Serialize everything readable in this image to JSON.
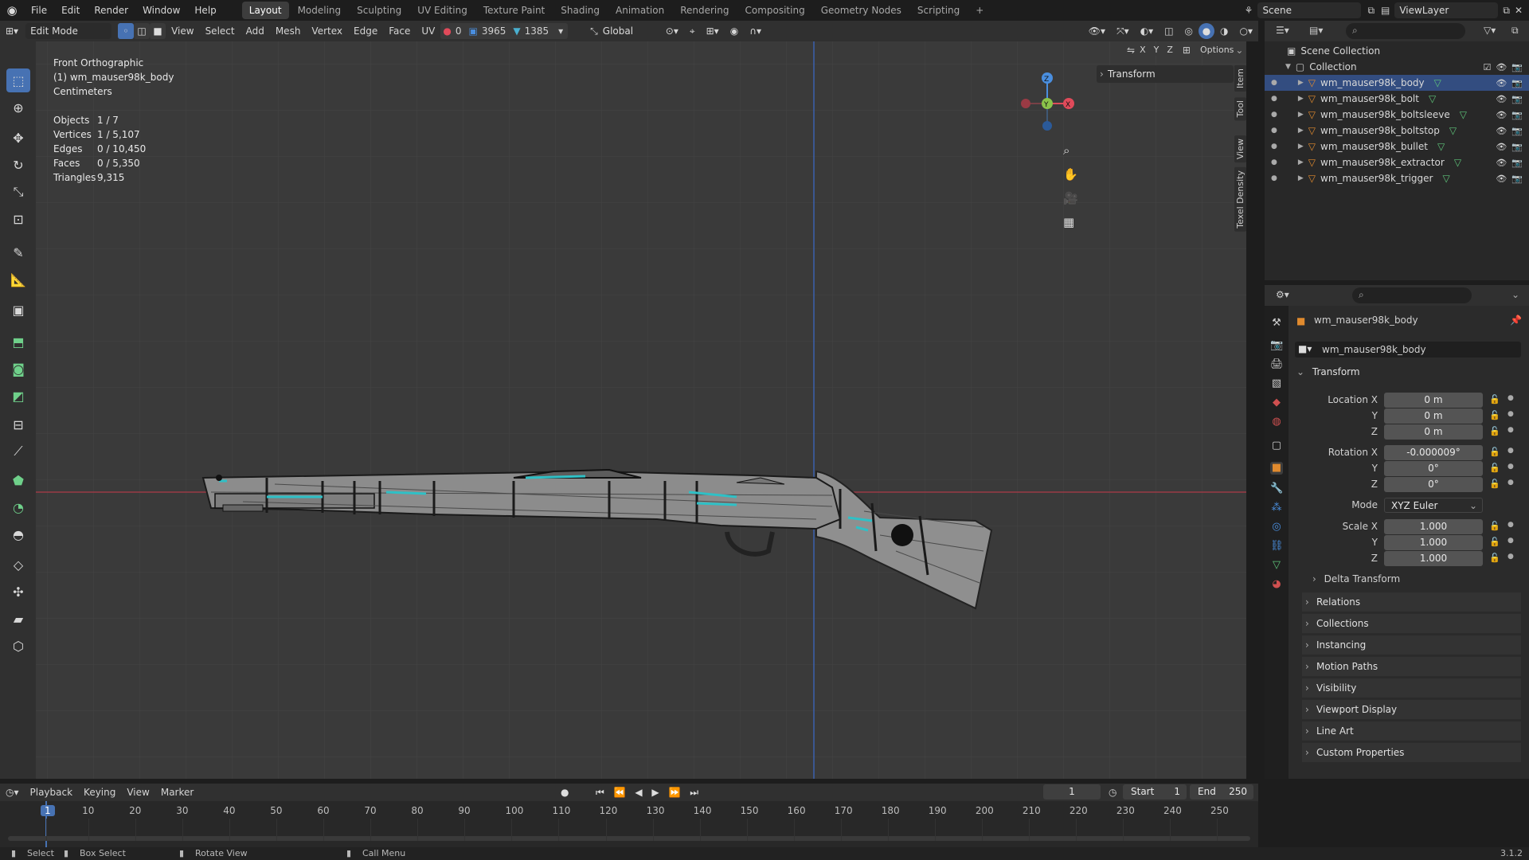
{
  "menu": [
    "File",
    "Edit",
    "Render",
    "Window",
    "Help"
  ],
  "workspaces": [
    "Layout",
    "Modeling",
    "Sculpting",
    "UV Editing",
    "Texture Paint",
    "Shading",
    "Animation",
    "Rendering",
    "Compositing",
    "Geometry Nodes",
    "Scripting"
  ],
  "scene": {
    "name": "Scene",
    "view_layer": "ViewLayer"
  },
  "header": {
    "mode": "Edit Mode",
    "menus": [
      "View",
      "Select",
      "Add",
      "Mesh",
      "Vertex",
      "Edge",
      "Face",
      "UV"
    ],
    "counts": {
      "a": "0",
      "b": "3965",
      "c": "1385"
    },
    "orientation": "Global",
    "options": "Options",
    "axes": [
      "X",
      "Y",
      "Z"
    ]
  },
  "viewport": {
    "view_name": "Front Orthographic",
    "object": "(1) wm_mauser98k_body",
    "units": "Centimeters",
    "stats": [
      {
        "label": "Objects",
        "value": "1 / 7"
      },
      {
        "label": "Vertices",
        "value": "1 / 5,107"
      },
      {
        "label": "Edges",
        "value": "0 / 10,450"
      },
      {
        "label": "Faces",
        "value": "0 / 5,350"
      },
      {
        "label": "Triangles",
        "value": "9,315"
      }
    ],
    "gizmo": {
      "z": "Z",
      "y": "Y",
      "x": "X"
    },
    "npanel_title": "Transform",
    "side_tabs": [
      "Item",
      "Tool",
      "View",
      "Texel Density"
    ]
  },
  "outliner": {
    "root": "Scene Collection",
    "collection": "Collection",
    "items": [
      "wm_mauser98k_body",
      "wm_mauser98k_bolt",
      "wm_mauser98k_boltsleeve",
      "wm_mauser98k_boltstop",
      "wm_mauser98k_bullet",
      "wm_mauser98k_extractor",
      "wm_mauser98k_trigger"
    ]
  },
  "properties": {
    "object_name": "wm_mauser98k_body",
    "data_name": "wm_mauser98k_body",
    "transform_title": "Transform",
    "location": {
      "label": "Location X",
      "x": "0 m",
      "y": "0 m",
      "z": "0 m"
    },
    "rotation": {
      "label": "Rotation X",
      "x": "-0.000009°",
      "y": "0°",
      "z": "0°"
    },
    "mode_label": "Mode",
    "mode": "XYZ Euler",
    "scale": {
      "label": "Scale X",
      "x": "1.000",
      "y": "1.000",
      "z": "1.000"
    },
    "axis_y": "Y",
    "axis_z": "Z",
    "delta": "Delta Transform",
    "panels": [
      "Relations",
      "Collections",
      "Instancing",
      "Motion Paths",
      "Visibility",
      "Viewport Display",
      "Line Art",
      "Custom Properties"
    ]
  },
  "timeline": {
    "menus": [
      "Playback",
      "Keying",
      "View",
      "Marker"
    ],
    "current": "1",
    "start_label": "Start",
    "start": "1",
    "end_label": "End",
    "end": "250",
    "ticks": [
      "1",
      "10",
      "20",
      "30",
      "40",
      "50",
      "60",
      "70",
      "80",
      "90",
      "100",
      "110",
      "120",
      "130",
      "140",
      "150",
      "160",
      "170",
      "180",
      "190",
      "200",
      "210",
      "220",
      "230",
      "240",
      "250"
    ]
  },
  "status": {
    "select": "Select",
    "box_select": "Box Select",
    "rotate": "Rotate View",
    "call_menu": "Call Menu",
    "version": "3.1.2"
  },
  "colors": {
    "accent": "#4772b3",
    "selected_edge": "#2fc0c6",
    "x_axis": "#e04a5a",
    "y_axis": "#8bc34a",
    "z_axis": "#4a8fe0"
  }
}
